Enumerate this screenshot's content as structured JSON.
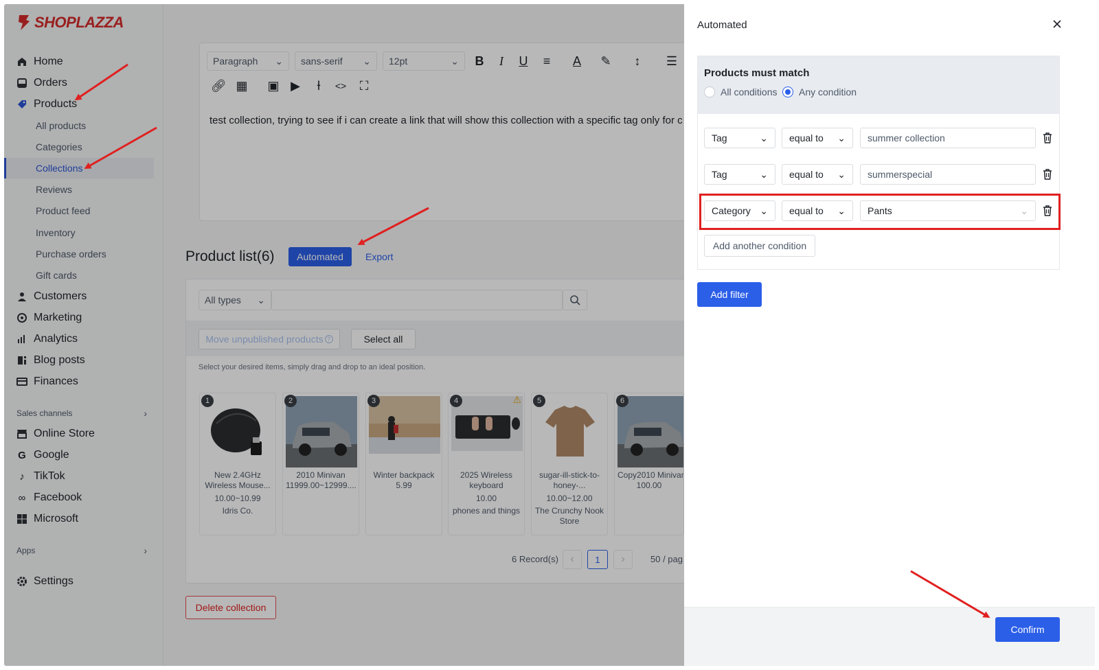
{
  "brand": {
    "name": "SHOPLAZZA"
  },
  "sidebar": {
    "items": [
      {
        "label": "Home",
        "icon": "home-icon"
      },
      {
        "label": "Orders",
        "icon": "orders-icon"
      },
      {
        "label": "Products",
        "icon": "tag-icon"
      }
    ],
    "products_sub": [
      "All products",
      "Categories",
      "Collections",
      "Reviews",
      "Product feed",
      "Inventory",
      "Purchase orders",
      "Gift cards"
    ],
    "active_sub": "Collections",
    "items2": [
      {
        "label": "Customers",
        "icon": "customers-icon"
      },
      {
        "label": "Marketing",
        "icon": "marketing-icon"
      },
      {
        "label": "Analytics",
        "icon": "analytics-icon"
      },
      {
        "label": "Blog posts",
        "icon": "blog-icon"
      },
      {
        "label": "Finances",
        "icon": "finances-icon"
      }
    ],
    "sales_channels_label": "Sales channels",
    "channels": [
      {
        "label": "Online Store",
        "icon": "store-icon"
      },
      {
        "label": "Google",
        "icon": "google-icon"
      },
      {
        "label": "TikTok",
        "icon": "tiktok-icon"
      },
      {
        "label": "Facebook",
        "icon": "meta-icon"
      },
      {
        "label": "Microsoft",
        "icon": "microsoft-icon"
      }
    ],
    "apps_label": "Apps",
    "settings_label": "Settings"
  },
  "editor": {
    "block_format": "Paragraph",
    "font_family": "sans-serif",
    "font_size": "12pt",
    "content": "test collection, trying to see if i can create a link that will show this collection with a specific tag only for c"
  },
  "product_list": {
    "title": "Product list(6)",
    "automated_label": "Automated",
    "export_label": "Export",
    "type_filter": "All types",
    "move_unpublished_label": "Move unpublished products",
    "select_all_label": "Select all",
    "hint": "Select your desired items, simply drag and drop to an ideal position.",
    "products": [
      {
        "num": "1",
        "name1": "New 2.4GHz",
        "name2": "Wireless Mouse...",
        "price": "10.00~10.99",
        "vendor": "Idris Co."
      },
      {
        "num": "2",
        "name1": "2010 Minivan",
        "name2": "11999.00~12999....",
        "price": "",
        "vendor": ""
      },
      {
        "num": "3",
        "name1": "Winter backpack",
        "name2": "5.99",
        "price": "",
        "vendor": ""
      },
      {
        "num": "4",
        "name1": "2025 Wireless",
        "name2": "keyboard",
        "price": "10.00",
        "vendor": "phones and things"
      },
      {
        "num": "5",
        "name1": "sugar-ill-stick-to-",
        "name2": "honey-...",
        "price": "10.00~12.00",
        "vendor": "The Crunchy Nook Store"
      },
      {
        "num": "6",
        "name1": "Copy2010 Minivan",
        "name2": "100.00",
        "price": "",
        "vendor": ""
      }
    ],
    "records": "6 Record(s)",
    "current_page": "1",
    "per_page": "50 / pag"
  },
  "delete_collection_label": "Delete collection",
  "drawer": {
    "title": "Automated",
    "match_heading": "Products must match",
    "match_options": [
      "All conditions",
      "Any condition"
    ],
    "match_selected": "Any condition",
    "conditions": [
      {
        "field": "Tag",
        "operator": "equal to",
        "value": "summer collection"
      },
      {
        "field": "Tag",
        "operator": "equal to",
        "value": "summerspecial"
      },
      {
        "field": "Category",
        "operator": "equal to",
        "value": "Pants"
      }
    ],
    "add_condition_label": "Add another condition",
    "add_filter_label": "Add filter",
    "confirm_label": "Confirm"
  },
  "colors": {
    "primary": "#2b5fe8",
    "accent_red": "#e02020",
    "brand_red": "#d42b2b"
  }
}
